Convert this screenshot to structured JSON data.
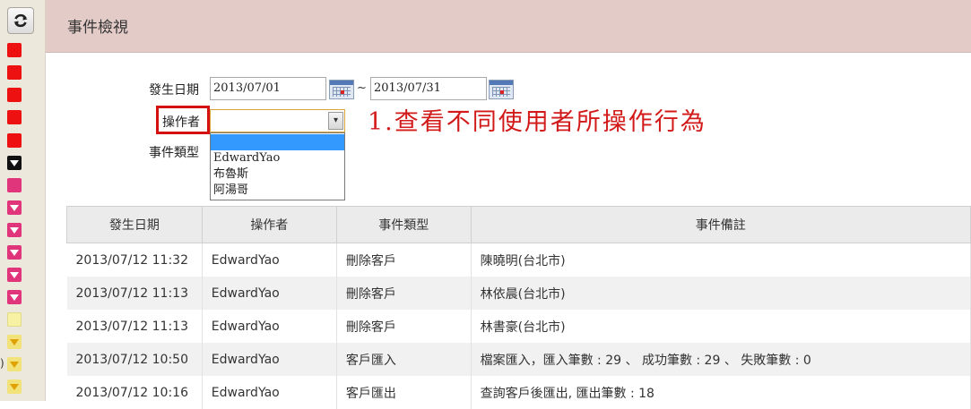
{
  "header": {
    "title": "事件檢視"
  },
  "sidebar": {
    "refresh_icon": "refresh-icon",
    "paren_text": ")"
  },
  "form": {
    "date_label": "發生日期",
    "date_from": "2013/07/01",
    "date_separator": "~",
    "date_to": "2013/07/31",
    "operator_label": "操作者",
    "operator_selected": "",
    "operator_options": [
      "",
      "EdwardYao",
      "布魯斯",
      "阿湯哥"
    ],
    "event_type_label": "事件類型"
  },
  "annotation": "1.查看不同使用者所操作行為",
  "table": {
    "headers": [
      "發生日期",
      "操作者",
      "事件類型",
      "事件備註"
    ],
    "rows": [
      [
        "2013/07/12 11:32",
        "EdwardYao",
        "刪除客戶",
        "陳曉明(台北市)"
      ],
      [
        "2013/07/12 11:13",
        "EdwardYao",
        "刪除客戶",
        "林依晨(台北市)"
      ],
      [
        "2013/07/12 11:13",
        "EdwardYao",
        "刪除客戶",
        "林書豪(台北市)"
      ],
      [
        "2013/07/12 10:50",
        "EdwardYao",
        "客戶匯入",
        "檔案匯入，匯入筆數 : 29 、 成功筆數 : 29 、 失敗筆數 : 0"
      ],
      [
        "2013/07/12 10:16",
        "EdwardYao",
        "客戶匯出",
        "查詢客戶後匯出, 匯出筆數 : 18"
      ]
    ]
  },
  "colors": {
    "header_bg": "#e3cbc8",
    "annotation": "#d21a1a",
    "highlight_box": "#d41010",
    "selected_option": "#3399ff"
  }
}
